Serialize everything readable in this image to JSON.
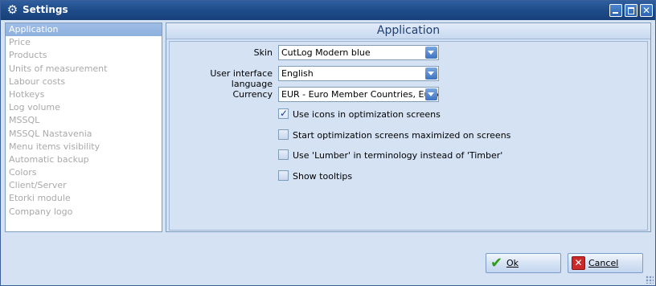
{
  "window": {
    "title": "Settings",
    "icon": "gear-icon"
  },
  "nav": {
    "items": [
      {
        "label": "Application",
        "selected": true
      },
      {
        "label": "Price"
      },
      {
        "label": "Products"
      },
      {
        "label": "Units of measurement"
      },
      {
        "label": "Labour costs"
      },
      {
        "label": "Hotkeys"
      },
      {
        "label": "Log volume"
      },
      {
        "label": "MSSQL"
      },
      {
        "label": "MSSQL Nastavenia"
      },
      {
        "label": "Menu items visibility"
      },
      {
        "label": "Automatic backup"
      },
      {
        "label": "Colors"
      },
      {
        "label": "Client/Server"
      },
      {
        "label": "Etorki module"
      },
      {
        "label": "Company logo"
      }
    ]
  },
  "panel": {
    "header": "Application",
    "skin": {
      "label": "Skin",
      "value": "CutLog Modern blue"
    },
    "language": {
      "label": "User interface language",
      "value": "English"
    },
    "currency": {
      "label": "Currency",
      "value": "EUR - Euro Member Countries, Euro"
    },
    "options": [
      {
        "label": "Use icons in optimization screens",
        "checked": true
      },
      {
        "label": "Start optimization screens maximized on screens",
        "checked": false
      },
      {
        "label": "Use 'Lumber' in terminology instead of 'Timber'",
        "checked": false
      },
      {
        "label": "Show tooltips",
        "checked": false
      }
    ]
  },
  "buttons": {
    "ok": "Ok",
    "cancel": "Cancel"
  },
  "colors": {
    "titlebar": "#1d4a87",
    "accent": "#8db0de",
    "header_text": "#1f3f6f"
  }
}
